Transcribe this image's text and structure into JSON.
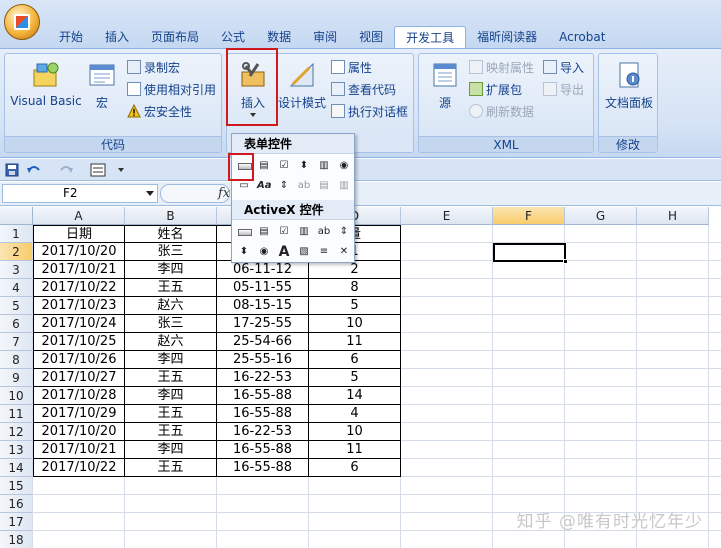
{
  "tabs": [
    "开始",
    "插入",
    "页面布局",
    "公式",
    "数据",
    "审阅",
    "视图",
    "开发工具",
    "福昕阅读器",
    "Acrobat"
  ],
  "active_tab_index": 7,
  "ribbon": {
    "code_group": {
      "label": "代码",
      "visual_basic": "Visual Basic",
      "macro": "宏",
      "record_macro": "录制宏",
      "relative_ref": "使用相对引用",
      "macro_security": "宏安全性"
    },
    "controls_group": {
      "insert": "插入",
      "design_mode": "设计模式",
      "properties": "属性",
      "view_code": "查看代码",
      "run_dialog": "执行对话框"
    },
    "xml_group": {
      "label": "XML",
      "source": "源",
      "map_properties": "映射属性",
      "expansion_packs": "扩展包",
      "refresh_data": "刷新数据",
      "import": "导入",
      "export": "导出"
    },
    "modify_group": {
      "label": "修改",
      "document_panel": "文档面板"
    }
  },
  "dropdown": {
    "form_controls_title": "表单控件",
    "activex_title": "ActiveX 控件"
  },
  "formula_bar": {
    "name_box": "F2",
    "fx": "fx"
  },
  "sheet": {
    "columns": [
      "A",
      "B",
      "C",
      "D",
      "E",
      "F",
      "G",
      "H"
    ],
    "selected_column": "F",
    "selected_row": 2,
    "header_row": [
      "日期",
      "姓名",
      "",
      "量"
    ],
    "rows": [
      [
        "2017/10/20",
        "张三",
        "",
        "1"
      ],
      [
        "2017/10/21",
        "李四",
        "06-11-12",
        "2"
      ],
      [
        "2017/10/22",
        "王五",
        "05-11-55",
        "8"
      ],
      [
        "2017/10/23",
        "赵六",
        "08-15-15",
        "5"
      ],
      [
        "2017/10/24",
        "张三",
        "17-25-55",
        "10"
      ],
      [
        "2017/10/25",
        "赵六",
        "25-54-66",
        "11"
      ],
      [
        "2017/10/26",
        "李四",
        "25-55-16",
        "6"
      ],
      [
        "2017/10/27",
        "王五",
        "16-22-53",
        "5"
      ],
      [
        "2017/10/28",
        "李四",
        "16-55-88",
        "14"
      ],
      [
        "2017/10/29",
        "王五",
        "16-55-88",
        "4"
      ],
      [
        "2017/10/20",
        "王五",
        "16-22-53",
        "10"
      ],
      [
        "2017/10/21",
        "李四",
        "16-55-88",
        "11"
      ],
      [
        "2017/10/22",
        "王五",
        "16-55-88",
        "6"
      ]
    ],
    "row_numbers": [
      "1",
      "2",
      "3",
      "4",
      "5",
      "6",
      "7",
      "8",
      "9",
      "10",
      "11",
      "12",
      "13",
      "14",
      "15",
      "16",
      "17",
      "18"
    ]
  },
  "watermark": "知乎 @唯有时光忆年少"
}
